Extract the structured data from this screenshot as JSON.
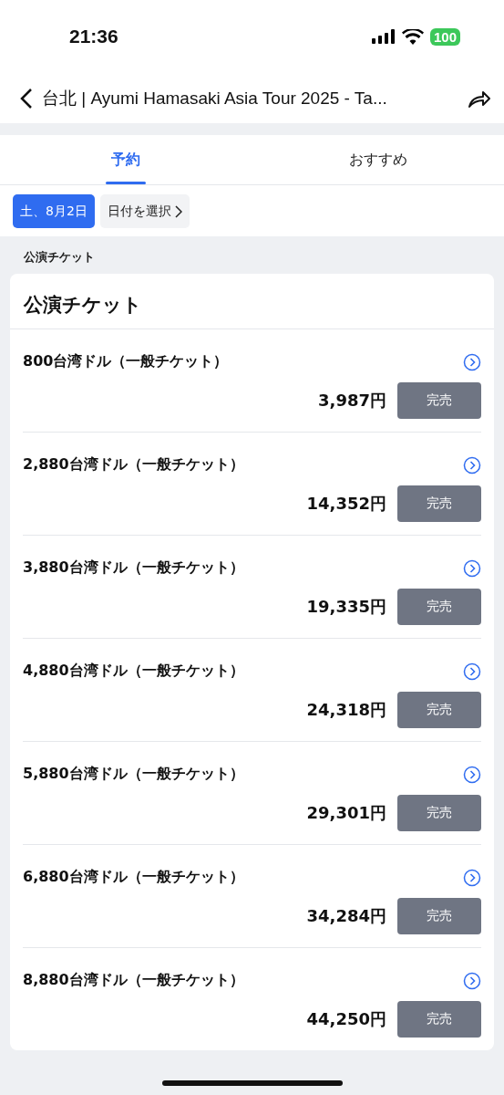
{
  "status_bar": {
    "time": "21:36",
    "battery": "100"
  },
  "header": {
    "title": "台北 | Ayumi Hamasaki Asia Tour 2025 - Ta..."
  },
  "tabs": [
    {
      "label": "予約",
      "selected": true
    },
    {
      "label": "おすすめ",
      "selected": false
    }
  ],
  "dates": [
    {
      "label": "土、8月2日",
      "selected": true
    },
    {
      "label": "日付を選択",
      "selected": false
    }
  ],
  "section_label": "公演チケット",
  "card": {
    "title": "公演チケット",
    "tickets": [
      {
        "name": "800台湾ドル（一般チケット）",
        "price": "3,987円",
        "button": "完売",
        "disabled": true
      },
      {
        "name": "2,880台湾ドル（一般チケット）",
        "price": "14,352円",
        "button": "完売",
        "disabled": true
      },
      {
        "name": "3,880台湾ドル（一般チケット）",
        "price": "19,335円",
        "button": "完売",
        "disabled": true
      },
      {
        "name": "4,880台湾ドル（一般チケット）",
        "price": "24,318円",
        "button": "完売",
        "disabled": true
      },
      {
        "name": "5,880台湾ドル（一般チケット）",
        "price": "29,301円",
        "button": "完売",
        "disabled": true
      },
      {
        "name": "6,880台湾ドル（一般チケット）",
        "price": "34,284円",
        "button": "完売",
        "disabled": true
      },
      {
        "name": "8,880台湾ドル（一般チケット）",
        "price": "44,250円",
        "button": "完売",
        "disabled": true
      }
    ]
  }
}
